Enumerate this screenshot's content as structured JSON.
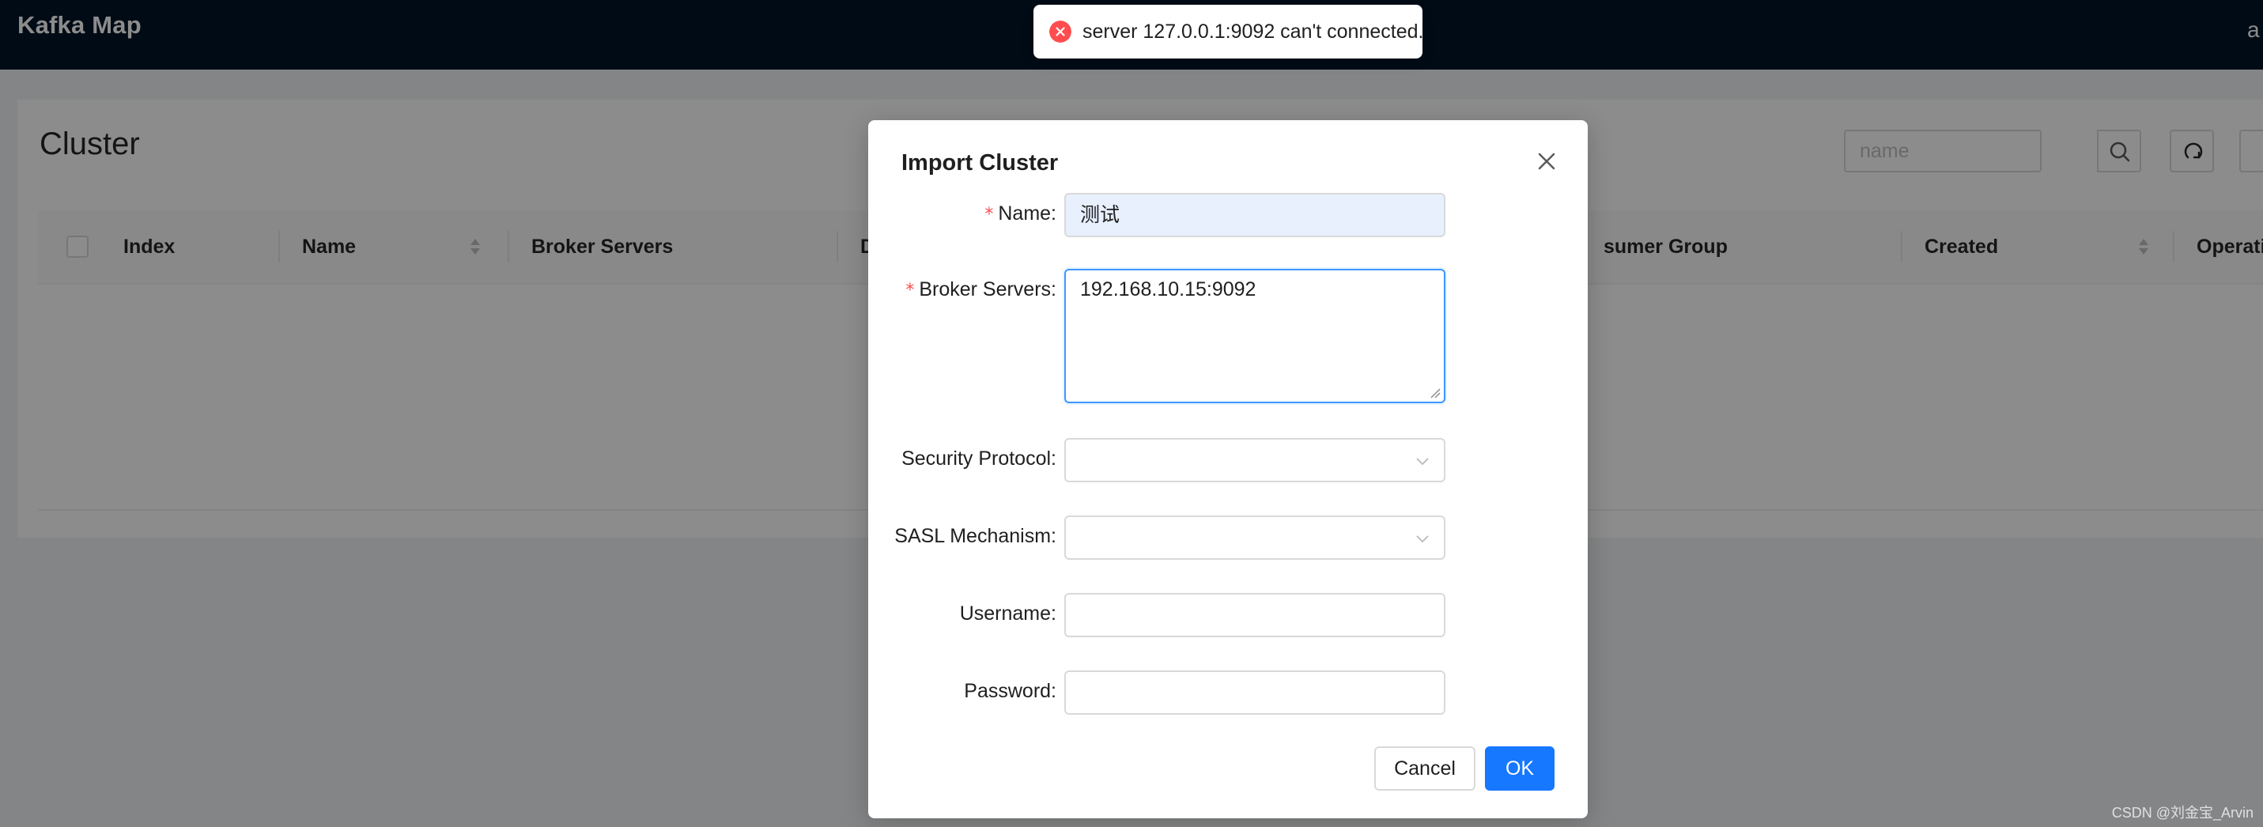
{
  "app": {
    "title": "Kafka Map",
    "top_right_text": "a"
  },
  "page": {
    "title": "Cluster"
  },
  "search": {
    "placeholder": "name"
  },
  "table": {
    "columns": [
      "Index",
      "Name",
      "Broker Servers",
      "De",
      "sumer Group",
      "Created",
      "Operation"
    ]
  },
  "toast": {
    "type": "error",
    "message": "server 127.0.0.1:9092 can't connected."
  },
  "modal": {
    "title": "Import Cluster",
    "fields": {
      "name": {
        "label": "Name",
        "required": "*",
        "value": "测试"
      },
      "broker_servers": {
        "label": "Broker Servers",
        "required": "*",
        "value": "192.168.10.15:9092"
      },
      "security_protocol": {
        "label": "Security Protocol",
        "value": ""
      },
      "sasl_mechanism": {
        "label": "SASL Mechanism",
        "value": ""
      },
      "username": {
        "label": "Username",
        "value": ""
      },
      "password": {
        "label": "Password",
        "value": ""
      }
    },
    "label_suffix": ":",
    "buttons": {
      "cancel": "Cancel",
      "ok": "OK"
    }
  },
  "watermark": "CSDN @刘金宝_Arvin",
  "colors": {
    "header_bg": "#001529",
    "primary": "#1677ff",
    "error": "#ff4d4f",
    "required": "#ff4d4f"
  },
  "icons": [
    "search-icon",
    "refresh-icon",
    "close-icon",
    "error-icon",
    "chevron-down-icon",
    "sort-icon"
  ]
}
